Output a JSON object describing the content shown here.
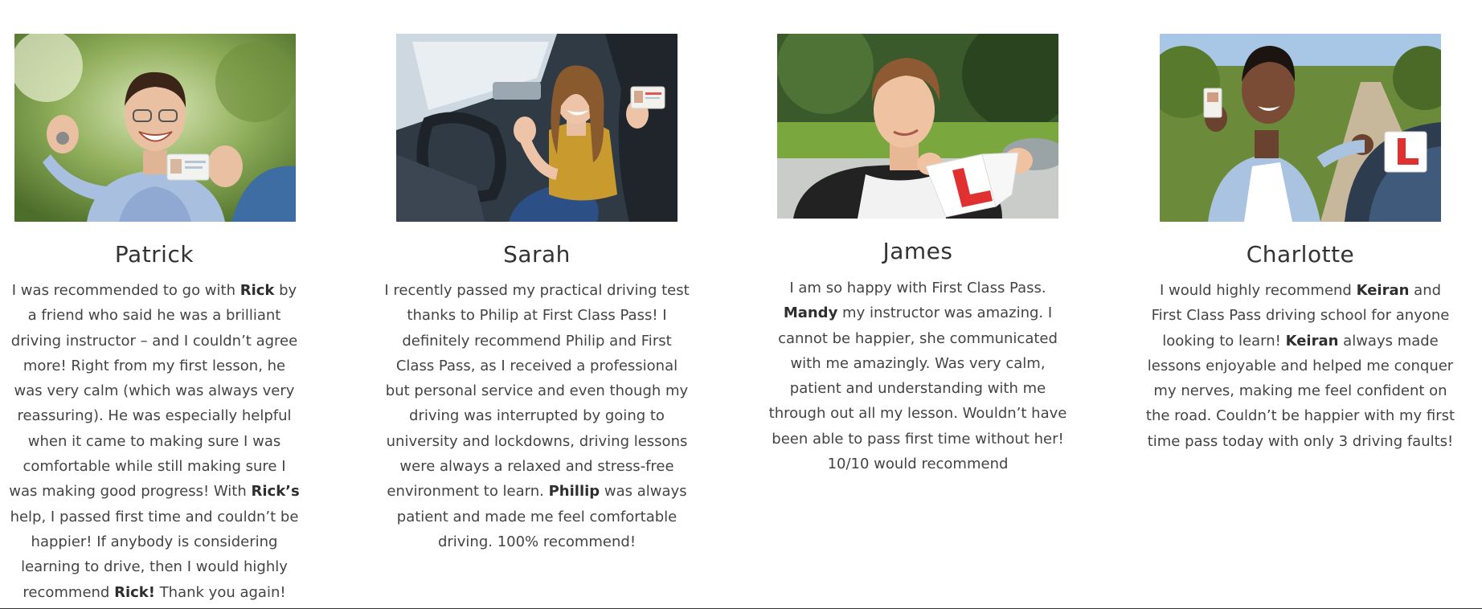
{
  "testimonials": [
    {
      "name": "Patrick",
      "image_alt": "Smiling young man with glasses holding up keys and a driving licence",
      "review": [
        {
          "t": "I was recommended to go with "
        },
        {
          "b": "Rick"
        },
        {
          "t": " by a friend who said he was a brilliant driving instructor – and I couldn’t agree more! Right from my first lesson, he was very calm (which was always very reassuring). He was especially helpful when it came to making sure I was comfortable while still making sure I was making good progress! With "
        },
        {
          "b": "Rick’s"
        },
        {
          "t": " help, I passed first time and couldn’t be happier! If anybody is considering learning to drive, then I would highly recommend "
        },
        {
          "b": "Rick!"
        },
        {
          "t": " Thank you again!"
        }
      ]
    },
    {
      "name": "Sarah",
      "image_alt": "Happy young woman sitting in a car holding up her driving licence",
      "review": [
        {
          "t": "I recently passed my practical driving test thanks to Philip at First Class Pass! I definitely recommend Philip and First Class Pass, as I received a professional but personal service and even though my driving was interrupted by going to university and lockdowns, driving lessons were always a relaxed and stress-free environment to learn. "
        },
        {
          "b": "Phillip"
        },
        {
          "t": " was always patient and made me feel comfortable driving. 100% recommend!"
        }
      ]
    },
    {
      "name": "James",
      "image_alt": "Teenage boy tearing up a red L plate",
      "review": [
        {
          "t": "I am so happy with First Class Pass. "
        },
        {
          "b": "Mandy"
        },
        {
          "t": " my instructor was amazing. I cannot be happier, she communicated with me amazingly. Was very calm, patient and understanding with me through out all my lesson. Wouldn’t have been able to pass first time without her! 10/10 would recommend"
        }
      ]
    },
    {
      "name": "Charlotte",
      "image_alt": "Smiling young woman holding a driving licence next to a car with an L plate",
      "review": [
        {
          "t": "I would highly recommend "
        },
        {
          "b": "Keiran"
        },
        {
          "t": " and First Class Pass driving school for anyone looking to learn! "
        },
        {
          "b": "Keiran"
        },
        {
          "t": " always made lessons enjoyable and helped me conquer my nerves, making me feel confident on the road. Couldn’t be happier with my first time pass today with only 3 driving faults!"
        }
      ]
    }
  ]
}
